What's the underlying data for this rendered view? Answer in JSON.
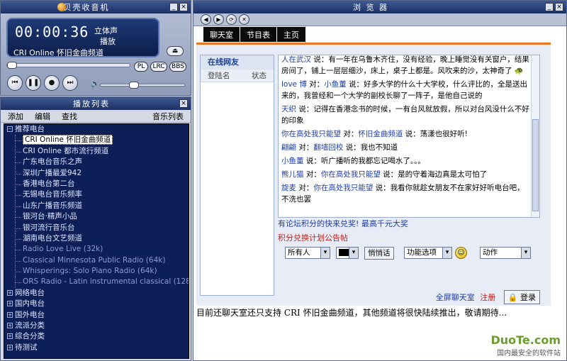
{
  "player": {
    "title": "贝壳收音机",
    "time": "00:00:36",
    "stereo": "立体声",
    "state": "播放",
    "station": "CRI Online 怀旧金曲频道",
    "buttons": {
      "pl": "PL",
      "lrc": "LRC",
      "bbs": "BBS"
    }
  },
  "playlist": {
    "title": "播放列表",
    "menu": [
      "添加",
      "编辑",
      "查找"
    ],
    "menu_right": "音乐列表",
    "groups_open": {
      "label": "推荐电台",
      "sign": "−"
    },
    "items": [
      "CRI Online 怀旧金曲频道",
      "CRI Online 都市流行频道",
      "广东电台音乐之声",
      "深圳广播最爱942",
      "香港电台第二台",
      "无锡电台音乐频率",
      "山东广播音乐频道",
      "银河台·精声小品",
      "银河流行音乐台",
      "湖南电台文艺频道",
      "Radio Love Live (32k)",
      "Classical Minnesota Public Radio (64k)",
      "Whisperings: Solo Piano Radio (64k)",
      "ORS Radio - Latin instrumental classical (128k)"
    ],
    "groups_closed": [
      "网络电台",
      "国内电台",
      "国外电台",
      "流派分类",
      "综合分类",
      "待测试"
    ]
  },
  "browser": {
    "title": "浏 览 器",
    "nav_icons": [
      "back-icon",
      "forward-icon",
      "refresh-icon",
      "stop-icon"
    ],
    "tabs": [
      "聊天室",
      "节目表",
      "主页"
    ],
    "online": {
      "header": "在线网友",
      "col1": "登陆名",
      "col2": "状态"
    },
    "messages": [
      {
        "nick": "人在武汉",
        "text": " 说：有一年在乌鲁木齐住，没有经验，晚上睡觉没有关窗户，结果房间了，铺上一层层细沙，床上，桌子上都是。风吹来的沙，太神奇了"
      },
      {
        "nick": "love 博",
        "to": "小鱼董",
        "text": " 说：好多大学的什么十大学校，什么评比的，全是送出来的，我曾经和一个大学的副校长聊了一阵子，是他自己说的"
      },
      {
        "nick": "天织",
        "text": " 说：记得在香港念书的时候，一有台风就放假，所以对台风没什么不好的印象"
      },
      {
        "nick": "你在高处我只能望",
        "to": "怀旧金曲频道",
        "text": " 说：荡漾也很好听!"
      },
      {
        "nick": "翩翩",
        "to": "翻墙回校",
        "text": " 说：我也不知道"
      },
      {
        "nick": "小鱼董",
        "text": " 说：听广播听的我都忘记喝水了。。。"
      },
      {
        "nick": "熊儿猫",
        "to": "你在高处我只能望",
        "text": " 说：是的守着海边真是太可怕了"
      },
      {
        "nick": "旋麦",
        "to": "你在高处我只能望",
        "text": " 说：我看你就趁女朋友不在家好好听电台吧，不洗也罢"
      }
    ],
    "to_word": " 对：",
    "promo_blue": "有论坛积分的快来兑奖! 最高千元大奖",
    "promo_red": "积分兑换计划公告帖",
    "controls": {
      "target": "所有人",
      "whisper": "悄悄话",
      "func": "功能选项",
      "action": "动作"
    },
    "fullscreen": "全屏聊天室",
    "register": "注册",
    "login": "登录",
    "notice": "目前还聊天室还只支持 CRI 怀旧金曲频道，其他频道将很快陆续推出，敬请期待...",
    "brand_main": "DuoTe.com",
    "brand_sub": "国内最安全的软件站"
  }
}
